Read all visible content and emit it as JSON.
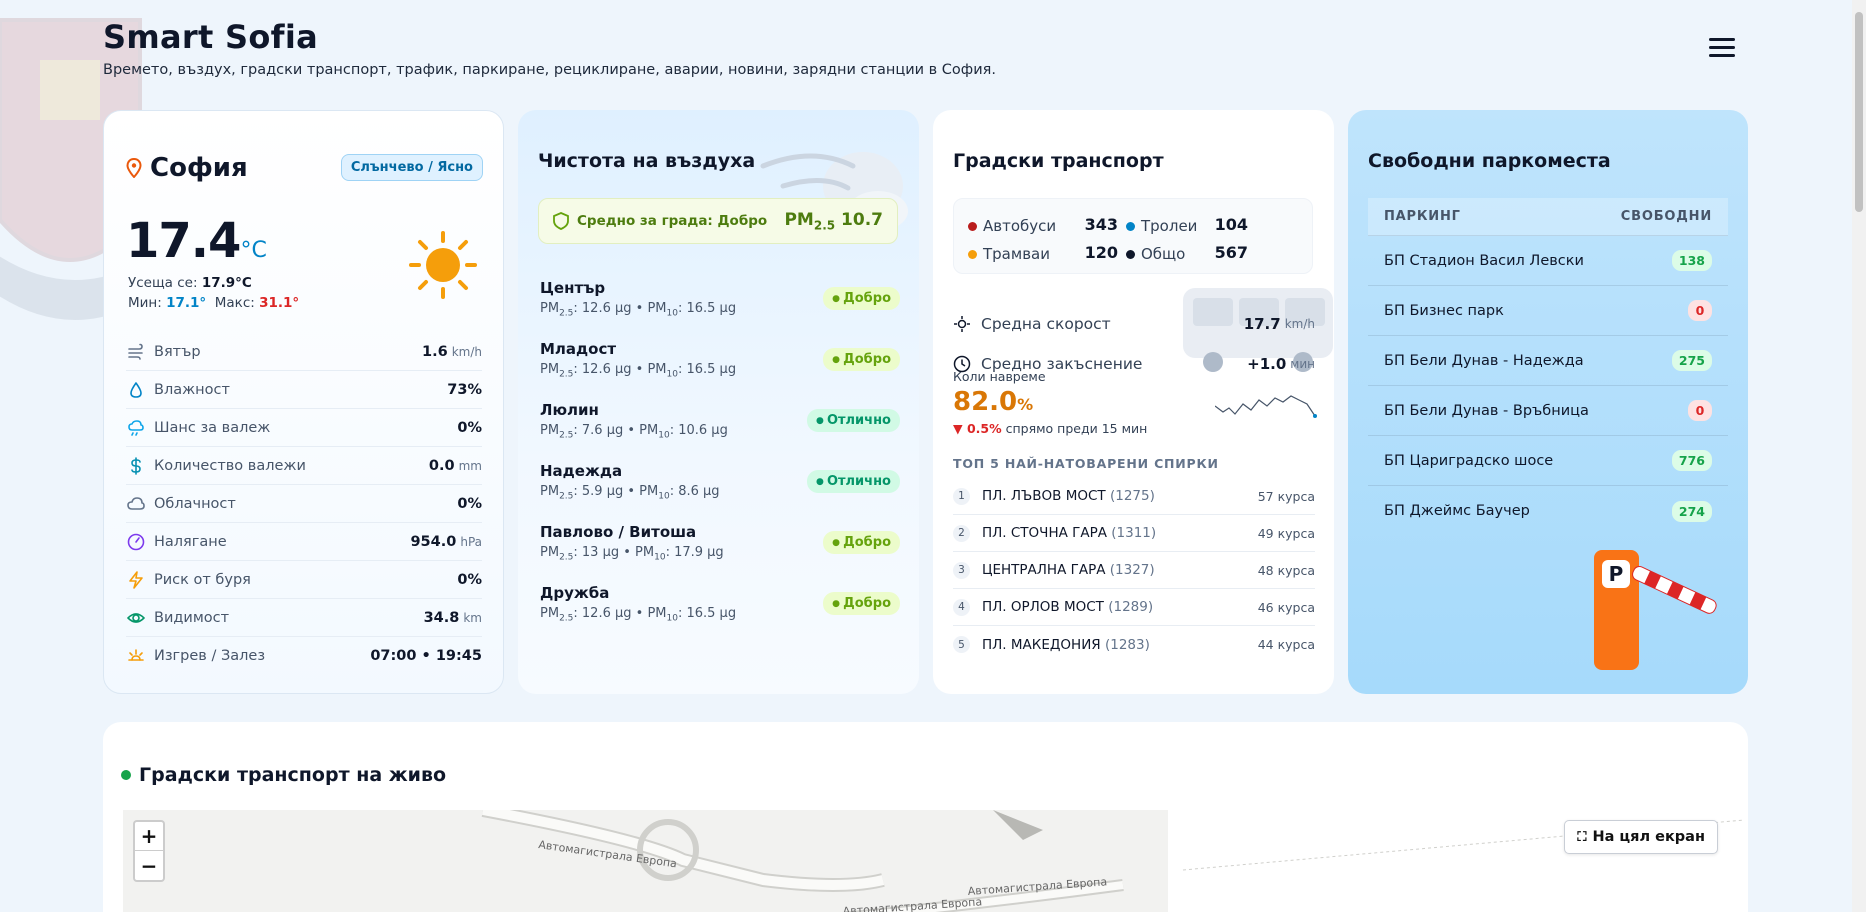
{
  "header": {
    "title": "Smart Sofia",
    "subtitle": "Времето, въздух, градски транспорт, трафик, паркиране, рециклиране, аварии, новини, зарядни станции в София."
  },
  "weather": {
    "city": "София",
    "condition": "Слънчево / Ясно",
    "temp": "17.4",
    "temp_unit": "°C",
    "feels_label": "Усеща се:",
    "feels_value": "17.9°C",
    "min_label": "Мин:",
    "min_value": "17.1°",
    "max_label": "Макс:",
    "max_value": "31.1°",
    "rows": [
      {
        "label": "Вятър",
        "value": "1.6",
        "unit": "km/h",
        "icon": "wind-icon",
        "color": "#64748b"
      },
      {
        "label": "Влажност",
        "value": "73%",
        "unit": "",
        "icon": "droplet-icon",
        "color": "#0284c7"
      },
      {
        "label": "Шанс за валеж",
        "value": "0%",
        "unit": "",
        "icon": "rain-cloud-icon",
        "color": "#0ea5e9"
      },
      {
        "label": "Количество валежи",
        "value": "0.0",
        "unit": "mm",
        "icon": "dollar-icon",
        "color": "#0891b2"
      },
      {
        "label": "Облачност",
        "value": "0%",
        "unit": "",
        "icon": "cloud-icon",
        "color": "#64748b"
      },
      {
        "label": "Налягане",
        "value": "954.0",
        "unit": "hPa",
        "icon": "gauge-icon",
        "color": "#7c3aed"
      },
      {
        "label": "Риск от буря",
        "value": "0%",
        "unit": "",
        "icon": "lightning-icon",
        "color": "#f59e0b"
      },
      {
        "label": "Видимост",
        "value": "34.8",
        "unit": "km",
        "icon": "eye-icon",
        "color": "#059669"
      },
      {
        "label": "Изгрев / Залез",
        "value": "07:00 • 19:45",
        "unit": "",
        "icon": "sunrise-icon",
        "color": "#f59e0b"
      }
    ]
  },
  "air": {
    "title": "Чистота на въздуха",
    "avg_label": "Средно за града: Добро",
    "avg_pm_label": "PM",
    "avg_pm_sub": "2.5",
    "avg_pm_value": "10.7",
    "items": [
      {
        "name": "Център",
        "pm25": "12.6 µg",
        "pm10": "16.5 µg",
        "status": "Добро",
        "kind": "good"
      },
      {
        "name": "Младост",
        "pm25": "12.6 µg",
        "pm10": "16.5 µg",
        "status": "Добро",
        "kind": "good"
      },
      {
        "name": "Люлин",
        "pm25": "7.6 µg",
        "pm10": "10.6 µg",
        "status": "Отлично",
        "kind": "exc"
      },
      {
        "name": "Надежда",
        "pm25": "5.9 µg",
        "pm10": "8.6 µg",
        "status": "Отлично",
        "kind": "exc"
      },
      {
        "name": "Павлово / Витоша",
        "pm25": "13 µg",
        "pm10": "17.9 µg",
        "status": "Добро",
        "kind": "good"
      },
      {
        "name": "Дружба",
        "pm25": "12.6 µg",
        "pm10": "16.5 µg",
        "status": "Добро",
        "kind": "good"
      }
    ]
  },
  "transport": {
    "title": "Градски транспорт",
    "counts": [
      {
        "label": "Автобуси",
        "value": "343",
        "color": "#b91c1c"
      },
      {
        "label": "Тролеи",
        "value": "104",
        "color": "#0284c7"
      },
      {
        "label": "Трамваи",
        "value": "120",
        "color": "#f59e0b"
      },
      {
        "label": "Общо",
        "value": "567",
        "color": "#0f172a"
      }
    ],
    "avg_speed_label": "Средна скорост",
    "avg_speed_value": "17.7",
    "avg_speed_unit": "km/h",
    "avg_delay_label": "Средно закъснение",
    "avg_delay_value": "+1.0",
    "avg_delay_unit": "мин",
    "ontime_label": "Коли навреме",
    "ontime_value": "82.0",
    "ontime_unit": "%",
    "delta_value": "0.5%",
    "delta_label": "спрямо преди 15 мин",
    "top_title": "ТОП 5 НАЙ-НАТОВАРЕНИ СПИРКИ",
    "stops": [
      {
        "rank": "1",
        "name": "ПЛ. ЛЪВОВ МОСТ",
        "id": "(1275)",
        "count": "57 курса"
      },
      {
        "rank": "2",
        "name": "ПЛ. СТОЧНА ГАРА",
        "id": "(1311)",
        "count": "49 курса"
      },
      {
        "rank": "3",
        "name": "ЦЕНТРАЛНА ГАРА",
        "id": "(1327)",
        "count": "48 курса"
      },
      {
        "rank": "4",
        "name": "ПЛ. ОРЛОВ МОСТ",
        "id": "(1289)",
        "count": "46 курса"
      },
      {
        "rank": "5",
        "name": "ПЛ. МАКЕДОНИЯ",
        "id": "(1283)",
        "count": "44 курса"
      }
    ]
  },
  "parking": {
    "title": "Свободни паркоместа",
    "col_name": "ПАРКИНГ",
    "col_free": "СВОБОДНИ",
    "rows": [
      {
        "name": "БП Стадион Васил Левски",
        "free": "138",
        "kind": "ok"
      },
      {
        "name": "БП Бизнес парк",
        "free": "0",
        "kind": "zero"
      },
      {
        "name": "БП Бели Дунав - Надежда",
        "free": "275",
        "kind": "ok"
      },
      {
        "name": "БП Бели Дунав - Връбница",
        "free": "0",
        "kind": "zero"
      },
      {
        "name": "БП Цариградско шосе",
        "free": "776",
        "kind": "ok"
      },
      {
        "name": "БП Джеймс Баучер",
        "free": "274",
        "kind": "ok"
      }
    ]
  },
  "live": {
    "title": "Градски транспорт на живо",
    "zoom_in": "+",
    "zoom_out": "−",
    "fullscreen_label": "На цял екран",
    "map_labels": [
      "Автомагистрала Европа",
      "Автомагистрала Европа",
      "Автомагистрала Европа"
    ]
  }
}
